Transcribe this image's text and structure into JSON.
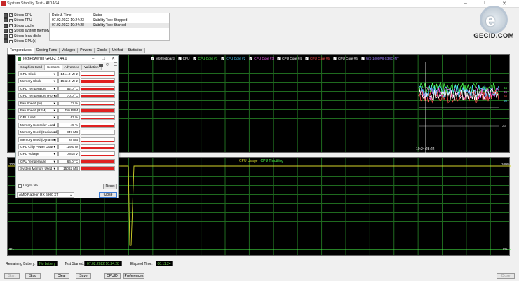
{
  "window": {
    "title": "System Stability Test - AIDA64",
    "min": "–",
    "max": "☐",
    "close": "✕"
  },
  "stress": [
    {
      "label": "Stress CPU",
      "checked": true
    },
    {
      "label": "Stress FPU",
      "checked": true
    },
    {
      "label": "Stress cache",
      "checked": true
    },
    {
      "label": "Stress system memory",
      "checked": true
    },
    {
      "label": "Stress local disks",
      "checked": false
    },
    {
      "label": "Stress GPU(s)",
      "checked": false
    }
  ],
  "status_table": {
    "headers": [
      "Date & Time",
      "Status"
    ],
    "rows": [
      [
        "07.02.2022 10:24:23",
        "Stability Test: Stopped"
      ],
      [
        "07.02.2022 10:24:28",
        "Stability Test: Started"
      ]
    ]
  },
  "logo": {
    "text": "GECID.COM",
    "letter": "e"
  },
  "tabs": [
    "Temperatures",
    "Cooling Fans",
    "Voltages",
    "Powers",
    "Clocks",
    "Unified",
    "Statistics"
  ],
  "temp_graph": {
    "legend": [
      {
        "label": "Motherboard",
        "color": "#ffffff"
      },
      {
        "label": "CPU",
        "color": "#ffffff"
      },
      {
        "label": "CPU Core #1",
        "color": "#4cff4c"
      },
      {
        "label": "CPU Core #2",
        "color": "#4dd2ff"
      },
      {
        "label": "CPU Core #3",
        "color": "#ff66ff"
      },
      {
        "label": "CPU Core #4",
        "color": "#ffffff"
      },
      {
        "label": "CPU Core #5",
        "color": "#ff5050"
      },
      {
        "label": "CPU Core #6",
        "color": "#ffffff"
      },
      {
        "label": "WX-1000P8-S3XC-NT",
        "color": "#a080ff"
      }
    ],
    "time_label": "10:24:28:22",
    "right_values": [
      "66",
      "65",
      "56",
      "50"
    ],
    "mid_value": "23"
  },
  "cpu_graph": {
    "title_a": "CPU Usage",
    "sep": "|",
    "title_b": "CPU Throttling",
    "top_left": "100%",
    "top_right": "100%",
    "bottom_left": "0%",
    "bottom_right": "0%"
  },
  "gpuz": {
    "title": "TechPowerUp GPU-Z 2.44.0",
    "tabs": [
      "Graphics Card",
      "Sensors",
      "Advanced",
      "Validation"
    ],
    "sensors": [
      {
        "name": "GPU Clock",
        "value": "1414.0 MHz",
        "fill": 0.25
      },
      {
        "name": "Memory Clock",
        "value": "1562.0 MHz",
        "fill": 0.9
      },
      {
        "name": "GPU Temperature",
        "value": "52.0 °C",
        "fill": 0.85
      },
      {
        "name": "GPU Temperature (Hot Spot)",
        "value": "70.0 °C",
        "fill": 0.85
      },
      {
        "name": "Fan Speed (%)",
        "value": "22 %",
        "fill": 0.12
      },
      {
        "name": "Fan Speed (RPM)",
        "value": "750 RPM",
        "fill": 0.9
      },
      {
        "name": "GPU Load",
        "value": "67 %",
        "fill": 0.5
      },
      {
        "name": "Memory Controller Load",
        "value": "45 %",
        "fill": 0.3
      },
      {
        "name": "Memory Used (Dedicated)",
        "value": "347 MB",
        "fill": 0.05
      },
      {
        "name": "Memory Used (Dynamic)",
        "value": "28 MB",
        "fill": 0.03
      },
      {
        "name": "GPU Chip Power Draw",
        "value": "119.0 W",
        "fill": 0.45
      },
      {
        "name": "GPU Voltage",
        "value": "0.818 V",
        "fill": 0.2
      },
      {
        "name": "CPU Temperature",
        "value": "66.0 °C",
        "fill": 0.85
      },
      {
        "name": "System Memory Used",
        "value": "15062 MB",
        "fill": 0.9
      }
    ],
    "log_label": "Log to file",
    "reset": "Reset",
    "device": "AMD Radeon RX 6900 XT",
    "close": "Close"
  },
  "bottom": {
    "battery_label": "Remaining Battery:",
    "battery_value": "No battery",
    "started_label": "Test Started:",
    "started_value": "07.02.2022 10:24:28",
    "elapsed_label": "Elapsed Time:",
    "elapsed_value": "00:11:24"
  },
  "buttons": [
    "Start",
    "Stop",
    "Clear",
    "Save",
    "CPUID",
    "Preferences"
  ],
  "close_button": "Close"
}
